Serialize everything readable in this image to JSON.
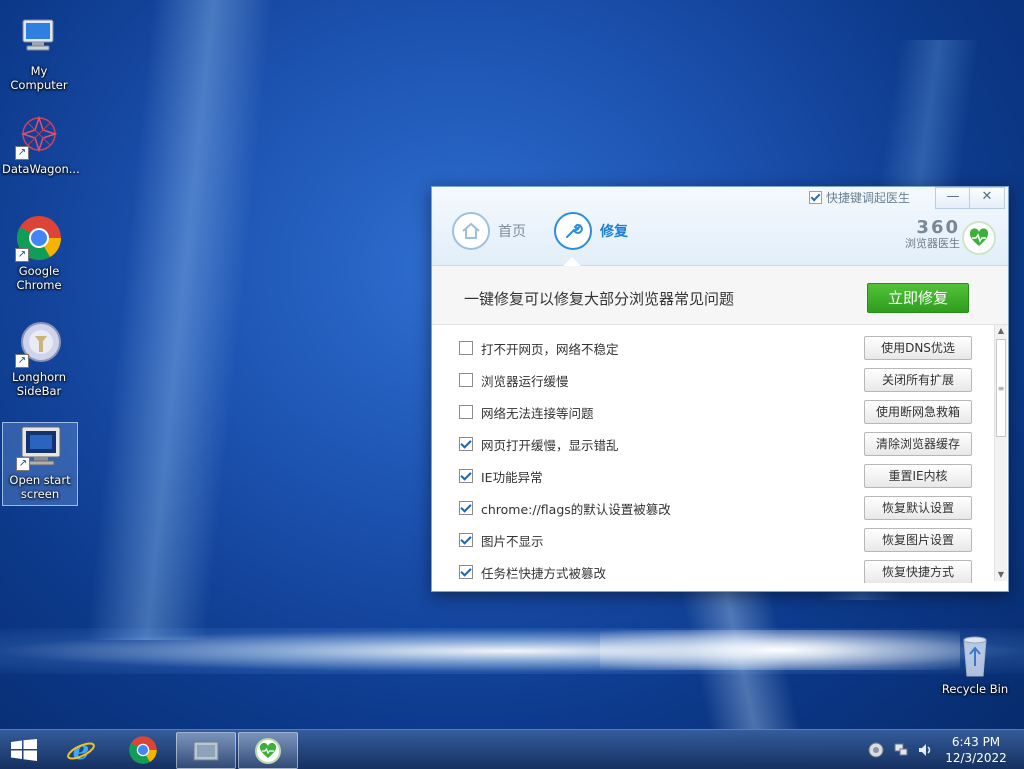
{
  "desktop": {
    "icons": [
      {
        "label": "My Computer"
      },
      {
        "label": "DataWagon..."
      },
      {
        "label": "Google Chrome"
      },
      {
        "label": "Longhorn SideBar"
      },
      {
        "label": "Open start screen"
      },
      {
        "label": "Recycle Bin"
      }
    ]
  },
  "window": {
    "quick_launch_label": "快捷键调起医生",
    "min_glyph": "—",
    "close_glyph": "✕",
    "nav": [
      {
        "label": "首页",
        "icon": "home-icon"
      },
      {
        "label": "修复",
        "icon": "wrench-icon"
      }
    ],
    "brand_number": "360",
    "brand_text": "浏览器医生",
    "banner_text": "一键修复可以修复大部分浏览器常见问题",
    "fix_button": "立即修复",
    "items": [
      {
        "label": "打不开网页，网络不稳定",
        "checked": false,
        "action": "使用DNS优选"
      },
      {
        "label": "浏览器运行缓慢",
        "checked": false,
        "action": "关闭所有扩展"
      },
      {
        "label": "网络无法连接等问题",
        "checked": false,
        "action": "使用断网急救箱"
      },
      {
        "label": "网页打开缓慢，显示错乱",
        "checked": true,
        "action": "清除浏览器缓存"
      },
      {
        "label": "IE功能异常",
        "checked": true,
        "action": "重置IE内核"
      },
      {
        "label": "chrome://flags的默认设置被篡改",
        "checked": true,
        "action": "恢复默认设置"
      },
      {
        "label": "图片不显示",
        "checked": true,
        "action": "恢复图片设置"
      },
      {
        "label": "任务栏快捷方式被篡改",
        "checked": true,
        "action": "恢复快捷方式"
      }
    ]
  },
  "taskbar": {
    "time": "6:43 PM",
    "date": "12/3/2022"
  },
  "colors": {
    "accent": "#1f7fd2",
    "fix_green": "#3aae27",
    "desktop_blue": "#1c52b0"
  }
}
